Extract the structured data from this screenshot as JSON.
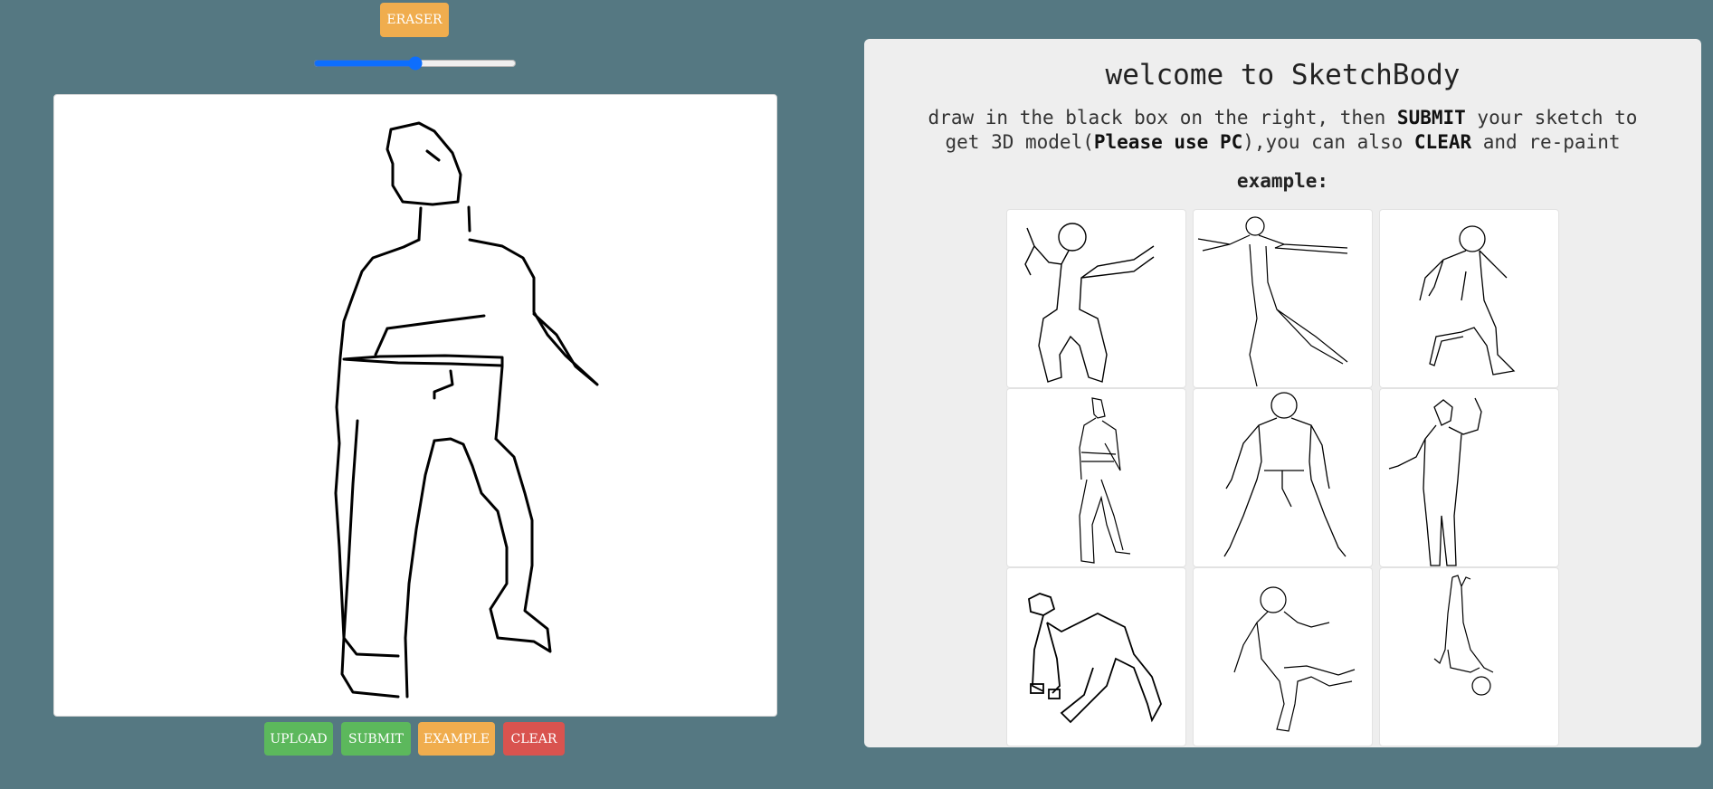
{
  "toolbar": {
    "eraser_label": "ERASER",
    "brush_size": 50
  },
  "actions": {
    "upload_label": "UPLOAD",
    "submit_label": "SUBMIT",
    "example_label": "EXAMPLE",
    "clear_label": "CLEAR"
  },
  "panel": {
    "title": "welcome to SketchBody",
    "desc_part1": "draw in the black box on the right, then ",
    "desc_submit": "SUBMIT",
    "desc_part2": " your sketch to get 3D model(",
    "desc_pc": "Please use PC",
    "desc_part3": "),you can also ",
    "desc_clear": "CLEAR",
    "desc_part4": " and re-paint",
    "example_label": "example:"
  },
  "colors": {
    "background": "#557882",
    "panel": "#eeeeee",
    "orange": "#f0ad4e",
    "green": "#5cb85c",
    "red": "#d9534f",
    "slider": "#0d6efd"
  },
  "gallery": {
    "items": [
      {
        "name": "example-sketch-1"
      },
      {
        "name": "example-sketch-2"
      },
      {
        "name": "example-sketch-3"
      },
      {
        "name": "example-sketch-4"
      },
      {
        "name": "example-sketch-5"
      },
      {
        "name": "example-sketch-6"
      },
      {
        "name": "example-sketch-7"
      },
      {
        "name": "example-sketch-8"
      },
      {
        "name": "example-sketch-9"
      }
    ]
  }
}
